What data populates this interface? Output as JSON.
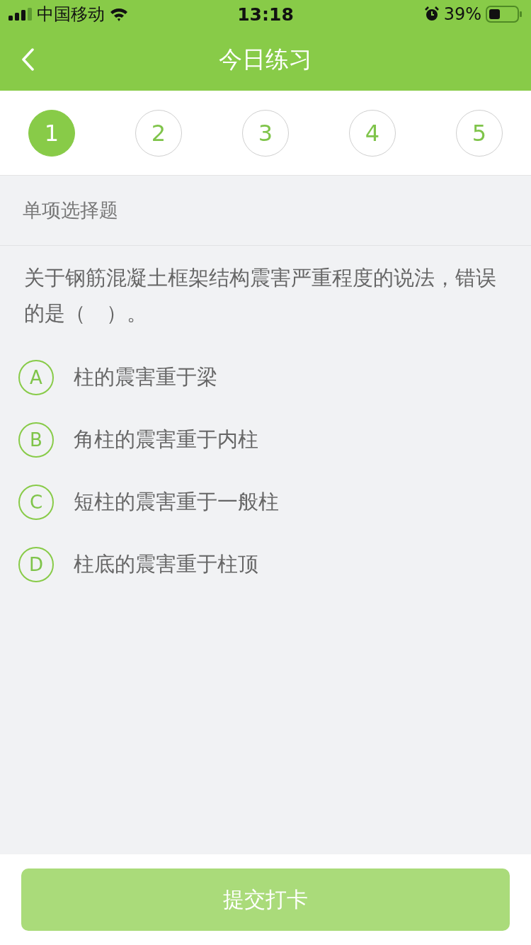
{
  "status_bar": {
    "carrier": "中国移动",
    "time": "13:18",
    "battery": "39%"
  },
  "nav": {
    "title": "今日练习"
  },
  "steps": [
    {
      "label": "1",
      "selected": true
    },
    {
      "label": "2",
      "selected": false
    },
    {
      "label": "3",
      "selected": false
    },
    {
      "label": "4",
      "selected": false
    },
    {
      "label": "5",
      "selected": false
    }
  ],
  "question": {
    "type_label": "单项选择题",
    "text": "关于钢筋混凝土框架结构震害严重程度的说法，错误的是（　）。",
    "options": [
      {
        "letter": "A",
        "text": "柱的震害重于梁",
        "selected": false
      },
      {
        "letter": "B",
        "text": "角柱的震害重于内柱",
        "selected": false
      },
      {
        "letter": "C",
        "text": "短柱的震害重于一般柱",
        "selected": false
      },
      {
        "letter": "D",
        "text": "柱底的震害重于柱顶",
        "selected": false
      }
    ]
  },
  "submit": {
    "label": "提交打卡",
    "disabled": true
  }
}
